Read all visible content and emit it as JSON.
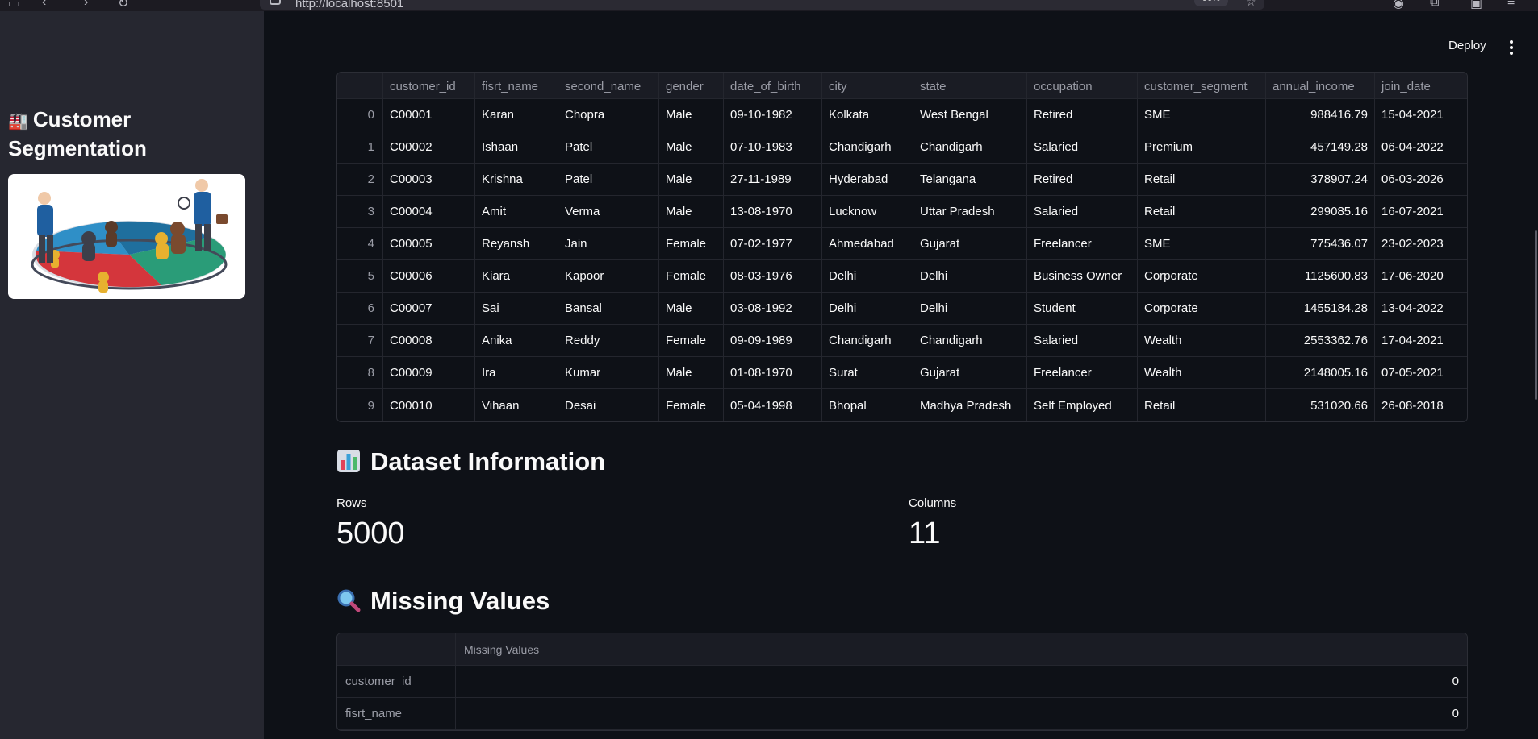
{
  "browser": {
    "url": "http://localhost:8501",
    "zoom": "90%"
  },
  "sidebar": {
    "title_emoji": "🏭",
    "title": "Customer Segmentation",
    "image_alt": "Customer segmentation illustration"
  },
  "header": {
    "deploy_label": "Deploy"
  },
  "dataframe": {
    "columns": [
      "",
      "customer_id",
      "fisrt_name",
      "second_name",
      "gender",
      "date_of_birth",
      "city",
      "state",
      "occupation",
      "customer_segment",
      "annual_income",
      "join_date"
    ],
    "rows": [
      [
        "0",
        "C00001",
        "Karan",
        "Chopra",
        "Male",
        "09-10-1982",
        "Kolkata",
        "West Bengal",
        "Retired",
        "SME",
        "988416.79",
        "15-04-2021"
      ],
      [
        "1",
        "C00002",
        "Ishaan",
        "Patel",
        "Male",
        "07-10-1983",
        "Chandigarh",
        "Chandigarh",
        "Salaried",
        "Premium",
        "457149.28",
        "06-04-2022"
      ],
      [
        "2",
        "C00003",
        "Krishna",
        "Patel",
        "Male",
        "27-11-1989",
        "Hyderabad",
        "Telangana",
        "Retired",
        "Retail",
        "378907.24",
        "06-03-2026"
      ],
      [
        "3",
        "C00004",
        "Amit",
        "Verma",
        "Male",
        "13-08-1970",
        "Lucknow",
        "Uttar Pradesh",
        "Salaried",
        "Retail",
        "299085.16",
        "16-07-2021"
      ],
      [
        "4",
        "C00005",
        "Reyansh",
        "Jain",
        "Female",
        "07-02-1977",
        "Ahmedabad",
        "Gujarat",
        "Freelancer",
        "SME",
        "775436.07",
        "23-02-2023"
      ],
      [
        "5",
        "C00006",
        "Kiara",
        "Kapoor",
        "Female",
        "08-03-1976",
        "Delhi",
        "Delhi",
        "Business Owner",
        "Corporate",
        "1125600.83",
        "17-06-2020"
      ],
      [
        "6",
        "C00007",
        "Sai",
        "Bansal",
        "Male",
        "03-08-1992",
        "Delhi",
        "Delhi",
        "Student",
        "Corporate",
        "1455184.28",
        "13-04-2022"
      ],
      [
        "7",
        "C00008",
        "Anika",
        "Reddy",
        "Female",
        "09-09-1989",
        "Chandigarh",
        "Chandigarh",
        "Salaried",
        "Wealth",
        "2553362.76",
        "17-04-2021"
      ],
      [
        "8",
        "C00009",
        "Ira",
        "Kumar",
        "Male",
        "01-08-1970",
        "Surat",
        "Gujarat",
        "Freelancer",
        "Wealth",
        "2148005.16",
        "07-05-2021"
      ],
      [
        "9",
        "C00010",
        "Vihaan",
        "Desai",
        "Female",
        "05-04-1998",
        "Bhopal",
        "Madhya Pradesh",
        "Self Employed",
        "Retail",
        "531020.66",
        "26-08-2018"
      ]
    ]
  },
  "dataset_info": {
    "heading_emoji": "📊",
    "heading": "Dataset Information",
    "rows_label": "Rows",
    "rows_value": "5000",
    "columns_label": "Columns",
    "columns_value": "11"
  },
  "missing_values": {
    "heading_emoji": "🔍",
    "heading": "Missing Values",
    "column_header": "Missing Values",
    "rows": [
      {
        "name": "customer_id",
        "value": "0"
      },
      {
        "name": "fisrt_name",
        "value": "0"
      }
    ]
  }
}
